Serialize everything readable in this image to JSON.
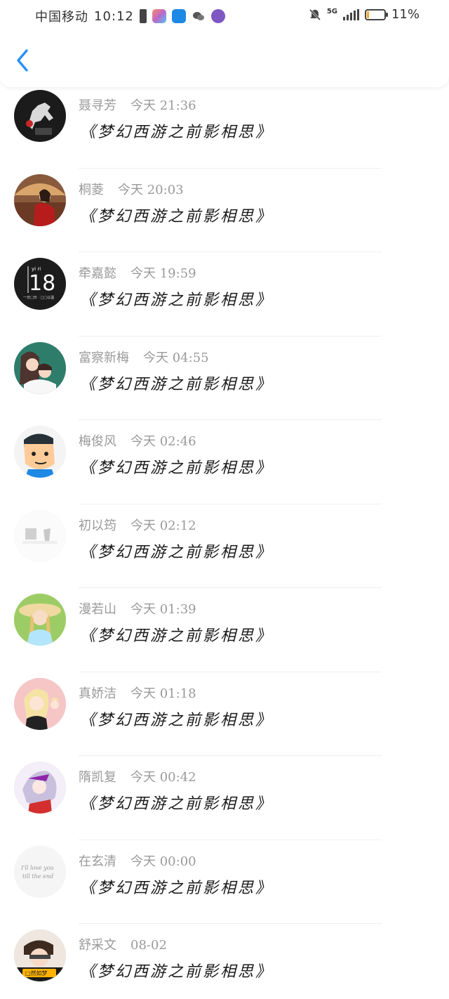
{
  "status_bar": {
    "carrier": "中国移动",
    "time": "10:12",
    "network": "5G",
    "battery": "11%",
    "battery_fraction": 0.11,
    "icons": [
      "warning-icon",
      "app-store-icon",
      "weather-icon",
      "wechat-icon",
      "music-icon",
      "mute-icon",
      "signal-icon",
      "battery-icon"
    ]
  },
  "nav": {
    "back_icon": "chevron-left-icon",
    "accent": "#2a8ff7"
  },
  "messages": [
    {
      "name": "聂寻芳",
      "time": "今天 21:36",
      "text": "《梦幻西游之前影相思》",
      "avatar": "horse-statue"
    },
    {
      "name": "桐菱",
      "time": "今天 20:03",
      "text": "《梦幻西游之前影相思》",
      "avatar": "girl-red-umbrella"
    },
    {
      "name": "牵嘉懿",
      "time": "今天 19:59",
      "text": "《梦幻西游之前影相思》",
      "avatar": "number-18-black"
    },
    {
      "name": "富察新梅",
      "time": "今天 04:55",
      "text": "《梦幻西游之前影相思》",
      "avatar": "couple-teal"
    },
    {
      "name": "梅俊风",
      "time": "今天 02:46",
      "text": "《梦幻西游之前影相思》",
      "avatar": "cartoon-man"
    },
    {
      "name": "初以筠",
      "time": "今天 02:12",
      "text": "《梦幻西游之前影相思》",
      "avatar": "faded-grey"
    },
    {
      "name": "漫若山",
      "time": "今天 01:39",
      "text": "《梦幻西游之前影相思》",
      "avatar": "girl-straw-hat"
    },
    {
      "name": "真娇洁",
      "time": "今天 01:18",
      "text": "《梦幻西游之前影相思》",
      "avatar": "anime-girl-blonde"
    },
    {
      "name": "隋凯复",
      "time": "今天 00:42",
      "text": "《梦幻西游之前影相思》",
      "avatar": "anime-girl-silver"
    },
    {
      "name": "在玄清",
      "time": "今天 00:00",
      "text": "《梦幻西游之前影相思》",
      "avatar": "handwriting-white"
    },
    {
      "name": "舒采文",
      "time": "08-02",
      "text": "《梦幻西游之前影相思》",
      "avatar": "boy-caption"
    }
  ],
  "avatar_captions": {
    "number-18-black": {
      "top": "yi ri",
      "number": "18",
      "bottom": "一日□日 · □□以温"
    },
    "handwriting-white": {
      "line1": "I'll love you",
      "line2": "till the end"
    },
    "boy-caption": {
      "caption": "□然如梦"
    }
  }
}
